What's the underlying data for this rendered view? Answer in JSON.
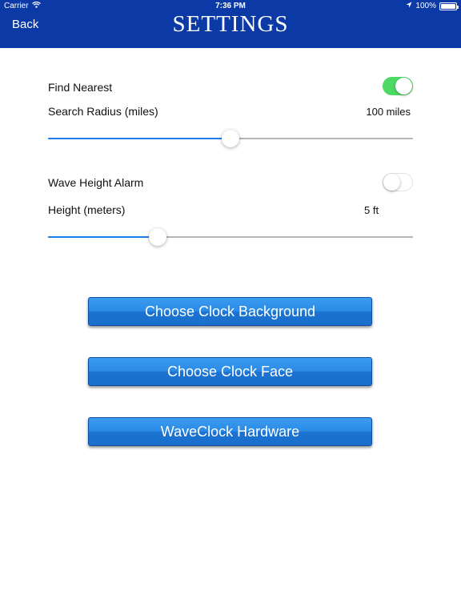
{
  "status_bar": {
    "carrier": "Carrier",
    "time": "7:36 PM",
    "battery": "100%",
    "battery_level": 1.0
  },
  "header": {
    "back_label": "Back",
    "title": "SETTINGS"
  },
  "settings": {
    "find_nearest": {
      "label": "Find Nearest",
      "enabled": true
    },
    "search_radius": {
      "label": "Search Radius (miles)",
      "value_text": "100 miles",
      "slider_fraction": 0.5
    },
    "wave_height_alarm": {
      "label": "Wave Height Alarm",
      "enabled": false
    },
    "height": {
      "label": "Height (meters)",
      "value_text": "5 ft",
      "slider_fraction": 0.3
    }
  },
  "buttons": {
    "choose_background": "Choose Clock Background",
    "choose_face": "Choose Clock Face",
    "hardware": "WaveClock Hardware"
  },
  "colors": {
    "header_bg": "#0b3aa6",
    "toggle_on": "#4cd964",
    "slider_fill": "#1d7ef0",
    "button_blue": "#2b8ae6"
  }
}
